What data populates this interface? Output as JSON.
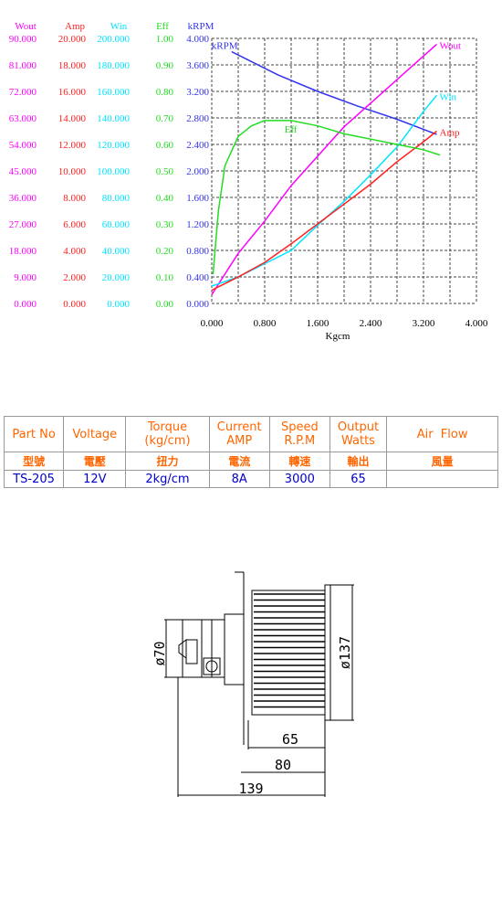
{
  "chart_data": {
    "type": "line",
    "title": "",
    "xlabel": "Kgcm",
    "xlim": [
      0,
      4.0
    ],
    "x_ticks": [
      "0.000",
      "0.800",
      "1.600",
      "2.400",
      "3.200",
      "4.000"
    ],
    "grid": true,
    "axes": [
      {
        "name": "Wout",
        "color": "#ff00ff",
        "range": [
          0,
          90
        ],
        "ticks": [
          "0.000",
          "9.000",
          "18.000",
          "27.000",
          "36.000",
          "45.000",
          "54.000",
          "63.000",
          "72.000",
          "81.000",
          "90.000"
        ]
      },
      {
        "name": "Amp",
        "color": "#ff2020",
        "range": [
          0,
          20
        ],
        "ticks": [
          "0.000",
          "2.000",
          "4.000",
          "6.000",
          "8.000",
          "10.000",
          "12.000",
          "14.000",
          "16.000",
          "18.000",
          "20.000"
        ]
      },
      {
        "name": "Win",
        "color": "#00e5ff",
        "range": [
          0,
          200
        ],
        "ticks": [
          "0.000",
          "20.000",
          "40.000",
          "60.000",
          "80.000",
          "100.000",
          "120.000",
          "140.000",
          "160.000",
          "180.000",
          "200.000"
        ]
      },
      {
        "name": "Eff",
        "color": "#22dd22",
        "range": [
          0,
          1
        ],
        "ticks": [
          "0.00",
          "0.10",
          "0.20",
          "0.30",
          "0.40",
          "0.50",
          "0.60",
          "0.70",
          "0.80",
          "0.90",
          "1.00"
        ]
      },
      {
        "name": "kRPM",
        "color": "#3333ee",
        "range": [
          0,
          4
        ],
        "ticks": [
          "0.000",
          "0.400",
          "0.800",
          "1.200",
          "1.600",
          "2.000",
          "2.400",
          "2.800",
          "3.200",
          "3.600",
          "4.000"
        ]
      }
    ],
    "series": [
      {
        "name": "kRPM",
        "label": "kRPM",
        "axis": "kRPM",
        "color": "#3333ee",
        "x": [
          0.3,
          1.0,
          1.6,
          2.2,
          2.8,
          3.4
        ],
        "y": [
          3.8,
          3.45,
          3.2,
          2.98,
          2.78,
          2.55
        ]
      },
      {
        "name": "Wout",
        "label": "Wout",
        "axis": "Wout",
        "color": "#ff00ff",
        "x": [
          0.0,
          0.4,
          0.8,
          1.2,
          1.6,
          2.0,
          2.4,
          2.8,
          3.2,
          3.4
        ],
        "y": [
          3.0,
          17,
          28,
          40,
          50,
          60,
          68,
          76,
          84,
          88
        ]
      },
      {
        "name": "Win",
        "label": "Win",
        "axis": "Win",
        "color": "#00e5ff",
        "x": [
          0.0,
          0.4,
          0.8,
          1.2,
          1.6,
          2.0,
          2.4,
          2.8,
          3.2,
          3.4
        ],
        "y": [
          13,
          20,
          30,
          40,
          59,
          77,
          97,
          118,
          145,
          157
        ]
      },
      {
        "name": "Amp",
        "label": "Amp",
        "axis": "Amp",
        "color": "#ff2020",
        "x": [
          0.0,
          0.4,
          0.8,
          1.2,
          1.6,
          2.0,
          2.4,
          2.8,
          3.2,
          3.4
        ],
        "y": [
          1.0,
          2.0,
          3.1,
          4.5,
          6.0,
          7.5,
          9.0,
          10.7,
          12.2,
          13.0
        ]
      },
      {
        "name": "Eff",
        "label": "Eff",
        "axis": "Eff",
        "color": "#22dd22",
        "x": [
          0.02,
          0.1,
          0.2,
          0.4,
          0.6,
          0.8,
          1.2,
          1.6,
          2.0,
          2.4,
          2.8,
          3.2,
          3.45
        ],
        "y": [
          0.11,
          0.35,
          0.52,
          0.63,
          0.67,
          0.69,
          0.69,
          0.67,
          0.64,
          0.62,
          0.6,
          0.58,
          0.56
        ]
      }
    ]
  },
  "spec_table": {
    "headers": [
      {
        "line1": "Part No",
        "line2": ""
      },
      {
        "line1": "Voltage",
        "line2": ""
      },
      {
        "line1": "Torque",
        "line2": "(kg/cm)"
      },
      {
        "line1": "Current",
        "line2": "AMP"
      },
      {
        "line1": "Speed",
        "line2": "R.P.M"
      },
      {
        "line1": "Output",
        "line2": "Watts"
      },
      {
        "line1": "Air  Flow",
        "line2": ""
      }
    ],
    "chinese_headers": [
      "型號",
      "電壓",
      "扭力",
      "電流",
      "轉速",
      "輸出",
      "風量"
    ],
    "row": [
      "TS-205",
      "12V",
      "2kg/cm",
      "8A",
      "3000",
      "65",
      ""
    ]
  },
  "drawing": {
    "dimensions": {
      "inner_diameter": "ø70",
      "outer_diameter": "ø137",
      "fan_length": "65",
      "body_length": "80",
      "total_length": "139"
    }
  }
}
